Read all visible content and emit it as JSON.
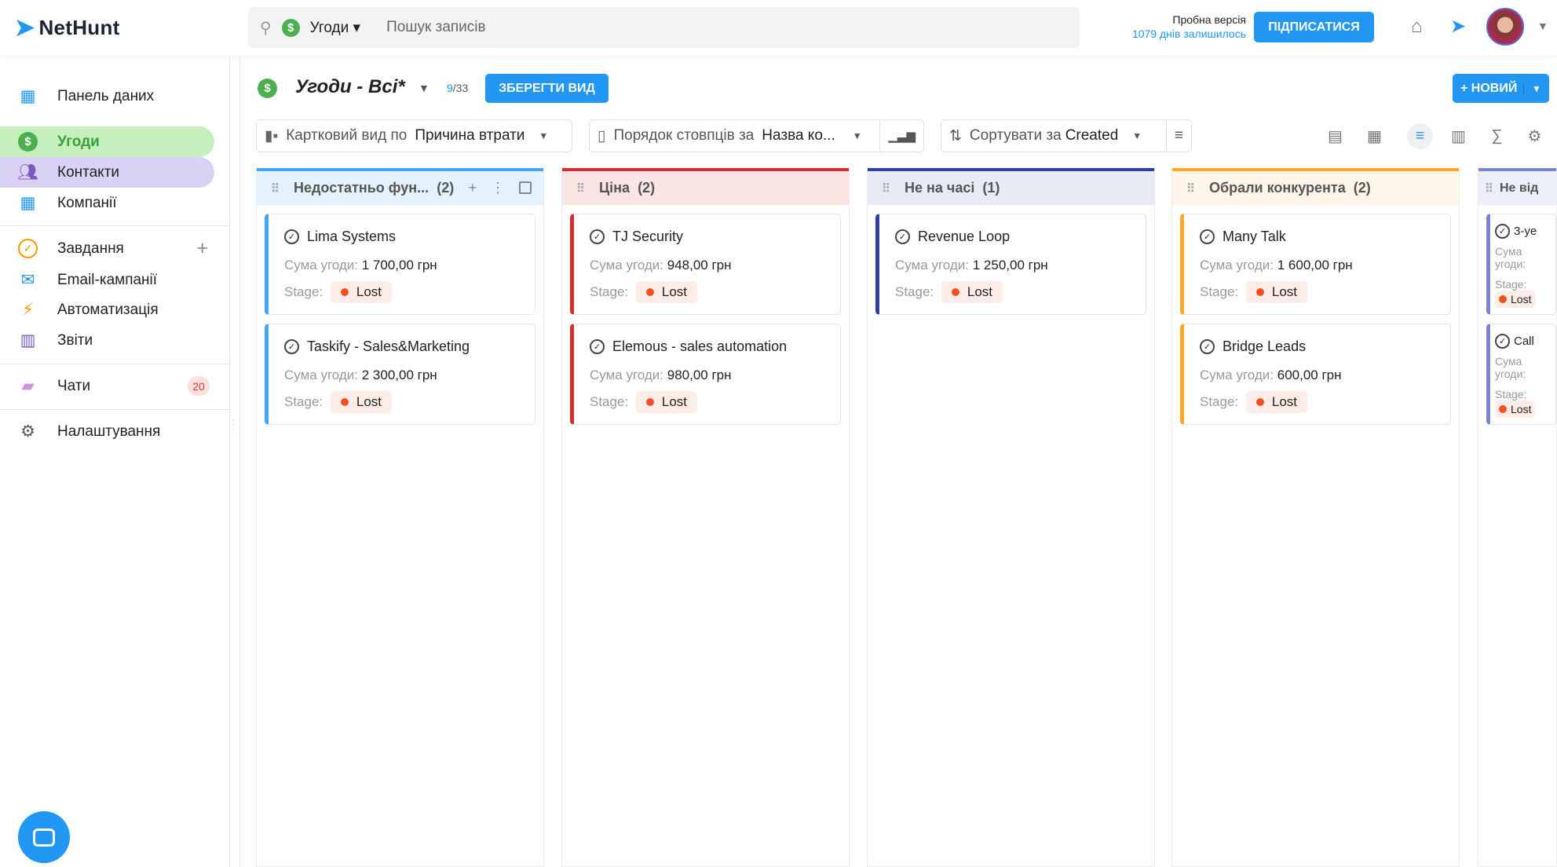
{
  "header": {
    "logo": "NetHunt",
    "search_entity": "Угоди",
    "search_placeholder": "Пошук записів",
    "trial_label": "Пробна версія",
    "trial_days": "1079 днів залишилось",
    "subscribe": "ПІДПИСАТИСЯ"
  },
  "sidebar": {
    "items": [
      {
        "label": "Панель даних",
        "icon": "dashboard-icon"
      },
      {
        "label": "Угоди",
        "icon": "dollar-icon"
      },
      {
        "label": "Контакти",
        "icon": "contacts-icon"
      },
      {
        "label": "Компанії",
        "icon": "companies-icon"
      },
      {
        "label": "Завдання",
        "icon": "tasks-icon"
      },
      {
        "label": "Email-кампанії",
        "icon": "email-icon"
      },
      {
        "label": "Автоматизація",
        "icon": "lightning-icon"
      },
      {
        "label": "Звіти",
        "icon": "reports-icon"
      },
      {
        "label": "Чати",
        "icon": "chat-icon",
        "badge": "20"
      },
      {
        "label": "Налаштування",
        "icon": "gear-icon"
      }
    ]
  },
  "view": {
    "title": "Угоди - Всі*",
    "count_current": "9",
    "count_total": "/33",
    "save_view": "ЗБЕРЕГТИ ВИД",
    "new": "+ НОВИЙ"
  },
  "toolbar": {
    "card_view_prefix": "Картковий вид по",
    "card_view_value": "Причина втрати",
    "column_order_prefix": "Порядок стовпців за",
    "column_order_value": "Назва ко...",
    "sort_prefix": "Сортувати за",
    "sort_value": "Created"
  },
  "card_labels": {
    "amount": "Сума угоди:",
    "stage": "Stage:",
    "stage_value": "Lost"
  },
  "columns": [
    {
      "title": "Недостатньо фун...",
      "count": "(2)",
      "color": "#42a5f5",
      "bg": "#e3f2fd",
      "cards": [
        {
          "name": "Lima Systems",
          "amount": "1 700,00 грн"
        },
        {
          "name": "Taskify - Sales&Marketing",
          "amount": "2 300,00 грн"
        }
      ]
    },
    {
      "title": "Ціна",
      "count": "(2)",
      "color": "#d32f2f",
      "bg": "#fbe4e4",
      "cards": [
        {
          "name": "TJ Security",
          "amount": "948,00 грн"
        },
        {
          "name": "Elemous - sales automation",
          "amount": "980,00 грн"
        }
      ]
    },
    {
      "title": "Не на часі",
      "count": "(1)",
      "color": "#303f9f",
      "bg": "#e8eaf6",
      "cards": [
        {
          "name": "Revenue Loop",
          "amount": "1 250,00 грн"
        }
      ]
    },
    {
      "title": "Обрали конкурента",
      "count": "(2)",
      "color": "#ffa726",
      "bg": "#fff5e8",
      "cards": [
        {
          "name": "Many Talk",
          "amount": "1 600,00 грн"
        },
        {
          "name": "Bridge Leads",
          "amount": "600,00 грн"
        }
      ]
    },
    {
      "title": "Не від",
      "count": "",
      "color": "#7986cb",
      "bg": "#eceef9",
      "cards": [
        {
          "name": "3-ye",
          "amount": ""
        },
        {
          "name": "Call",
          "amount": ""
        }
      ]
    }
  ]
}
